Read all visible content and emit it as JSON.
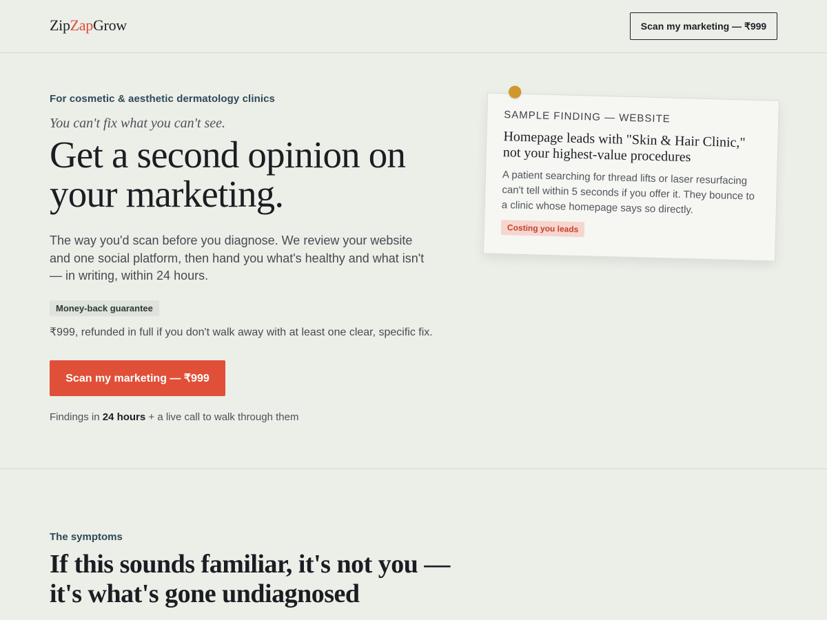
{
  "header": {
    "logo_part1": "Zip",
    "logo_part2": "Zap",
    "logo_part3": "Grow",
    "cta_label": "Scan my marketing — ₹999"
  },
  "hero": {
    "eyebrow": "For cosmetic & aesthetic dermatology clinics",
    "tagline": "You can't fix what you can't see.",
    "headline": "Get a second opinion on your marketing.",
    "lede": "The way you'd scan before you diagnose. We review your website and one social platform, then hand you what's healthy and what isn't — in writing, within 24 hours.",
    "badge": "Money-back guarantee",
    "guarantee": "₹999, refunded in full if you don't walk away with at least one clear, specific fix.",
    "cta_label": "Scan my marketing — ₹999",
    "findings_prefix": "Findings in ",
    "findings_bold": "24 hours",
    "findings_suffix": " + a live call to walk through them"
  },
  "sample_card": {
    "label": "SAMPLE FINDING — WEBSITE",
    "title": "Homepage leads with \"Skin & Hair Clinic,\" not your highest-value procedures",
    "body": "A patient searching for thread lifts or laser resurfacing can't tell within 5 seconds if you offer it. They bounce to a clinic whose homepage says so directly.",
    "tag": "Costing you leads"
  },
  "symptoms": {
    "eyebrow": "The symptoms",
    "title": "If this sounds familiar, it's not you — it's what's gone undiagnosed"
  },
  "colors": {
    "background": "#eceee8",
    "accent": "#e04f38",
    "pin": "#d0972a",
    "tag_bg": "#f7d6cf"
  }
}
